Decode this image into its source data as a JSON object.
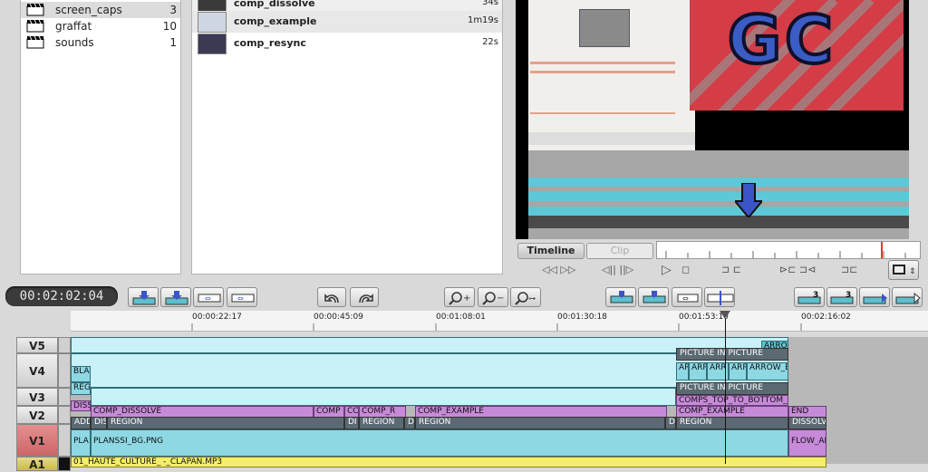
{
  "bins": [
    {
      "name": "screen_caps",
      "count": "3"
    },
    {
      "name": "graffat",
      "count": "10"
    },
    {
      "name": "sounds",
      "count": "1"
    }
  ],
  "clips": [
    {
      "name": "comp_dissolve",
      "duration": "34s"
    },
    {
      "name": "comp_example",
      "duration": "1m19s"
    },
    {
      "name": "comp_resync",
      "duration": "22s"
    }
  ],
  "viewer": {
    "tab_timeline": "Timeline",
    "tab_clip": "Clip",
    "logo_text": "GC"
  },
  "timecode": "00:02:02:04",
  "ruler": [
    "00:00:22:17",
    "00:00:45:09",
    "00:01:08:01",
    "00:01:30:18",
    "00:01:53:10",
    "00:02:16:02"
  ],
  "tracks": [
    "V5",
    "V4",
    "V3",
    "V2",
    "V1",
    "A1"
  ],
  "timeline": {
    "v5": [
      "ARROW"
    ],
    "v4_labels": [
      "BLA",
      "PICTURE IN PICTURE",
      "AR",
      "ARR",
      "ARR",
      "ARR",
      "ARROW_B"
    ],
    "v3_labels": [
      "REG",
      "PICTURE IN PICTURE",
      "COMPS_TOP_TO_BOTTOM_E"
    ],
    "v2_labels": [
      "DISSO",
      "COMP_DISSOLVE",
      "COMP",
      "CC",
      "COMP_R",
      "COMP_EXAMPLE",
      "COMP_EXAMPLE",
      "END"
    ],
    "v2_sub": [
      "ADD",
      "DIS",
      "REGION",
      "DI",
      "REGION",
      "D",
      "REGION",
      "DI",
      "REGION",
      "DISSOLV"
    ],
    "v1_labels": [
      "PLA",
      "PLANSSI_BG.PNG",
      "FLOW_AI"
    ],
    "a1_label": "01_HAUTE_CULTURE_ -_CLAPAN.MP3",
    "extra_labels": [
      "ADC",
      "PLA"
    ]
  }
}
